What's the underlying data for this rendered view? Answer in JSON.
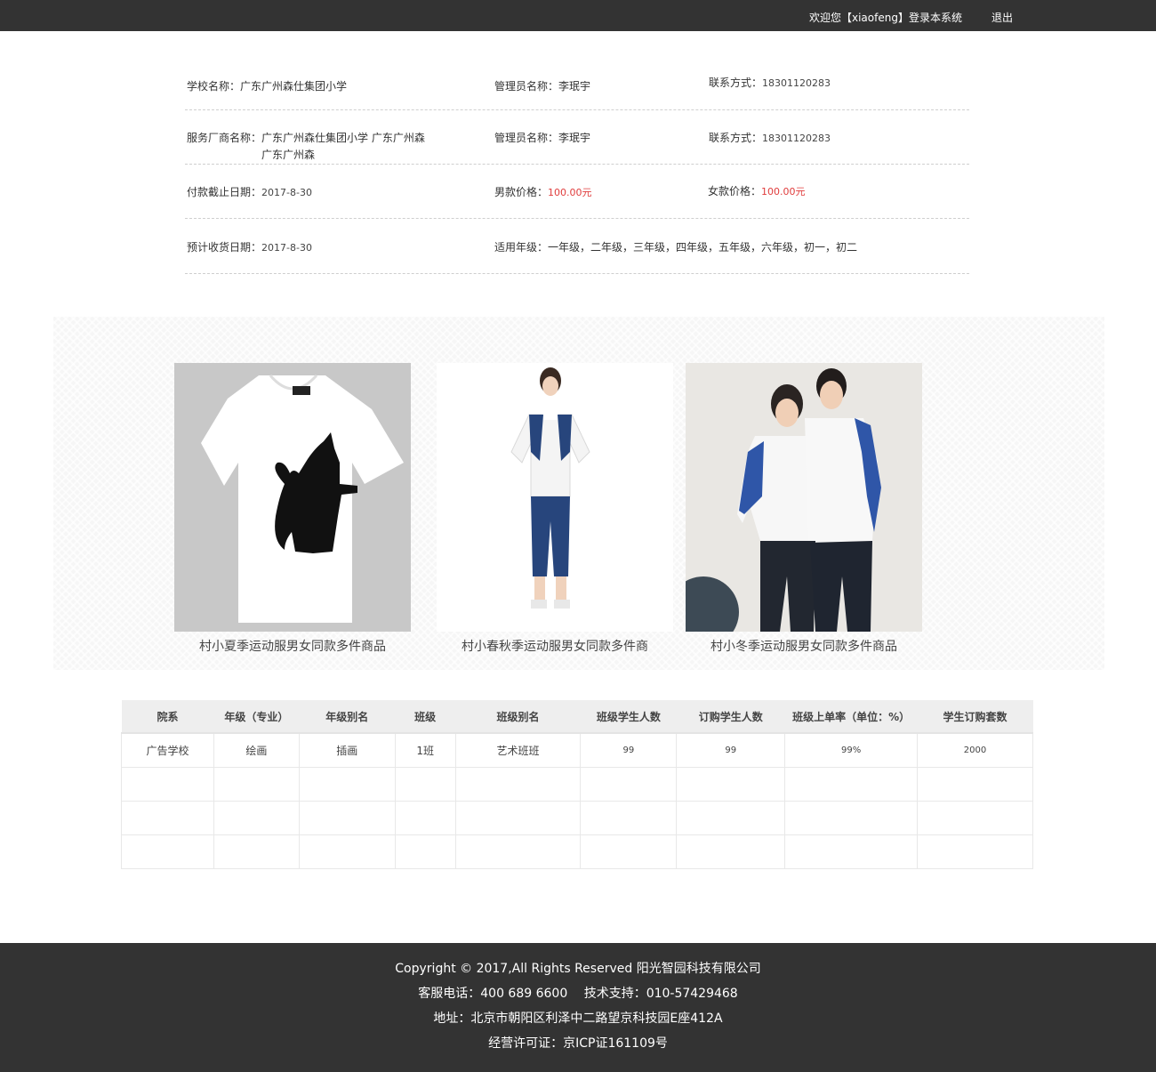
{
  "header": {
    "welcome": "欢迎您【xiaofeng】登录本系统",
    "logout": "退出"
  },
  "info": {
    "school_label": "学校名称：",
    "school_value": "广东广州森仕集团小学",
    "admin1_label": "管理员名称：",
    "admin1_value": "李珉宇",
    "contact1_label": "联系方式：",
    "contact1_value": "18301120283",
    "vendor_label": "服务厂商名称：",
    "vendor_value_line1": "广东广州森仕集团小学 广东广州森",
    "vendor_value_line2": "广东广州森",
    "admin2_label": "管理员名称：",
    "admin2_value": "李珉宇",
    "contact2_label": "联系方式：",
    "contact2_value": "18301120283",
    "pay_deadline_label": "付款截止日期：",
    "pay_deadline_value": "2017-8-30",
    "male_price_label": "男款价格：",
    "male_price_value": "100.00元",
    "female_price_label": "女款价格：",
    "female_price_value": "100.00元",
    "delivery_label": "预计收货日期：",
    "delivery_value": "2017-8-30",
    "grades_label": "适用年级：",
    "grades_value": "一年级，二年级，三年级，四年级，五年级，六年级，初一，初二"
  },
  "products": [
    {
      "caption": "村小夏季运动服男女同款多件商品"
    },
    {
      "caption": "村小春秋季运动服男女同款多件商"
    },
    {
      "caption": "村小冬季运动服男女同款多件商品"
    }
  ],
  "table": {
    "headers": [
      "院系",
      "年级（专业）",
      "年级别名",
      "班级",
      "班级别名",
      "班级学生人数",
      "订购学生人数",
      "班级上单率（单位：%）",
      "学生订购套数"
    ],
    "rows": [
      [
        "广告学校",
        "绘画",
        "插画",
        "1班",
        "艺术班班",
        "99",
        "99",
        "99%",
        "2000"
      ]
    ]
  },
  "footer": {
    "copyright": "Copyright © 2017,All Rights Reserved 阳光智园科技有限公司",
    "phone": "客服电话：400 689 6600　 技术支持：010-57429468",
    "address": "地址：北京市朝阳区利泽中二路望京科技园E座412A",
    "license": "经营许可证：京ICP证161109号"
  },
  "colors": {
    "topbar": "#333333",
    "price": "#e03c3c",
    "footer": "#333333"
  }
}
